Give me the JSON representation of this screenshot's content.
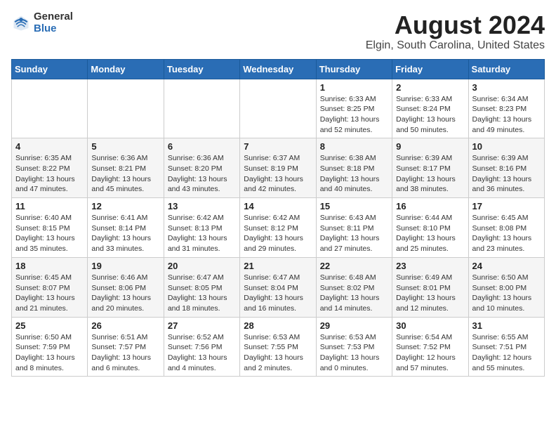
{
  "header": {
    "logo_general": "General",
    "logo_blue": "Blue",
    "title": "August 2024",
    "subtitle": "Elgin, South Carolina, United States"
  },
  "calendar": {
    "weekdays": [
      "Sunday",
      "Monday",
      "Tuesday",
      "Wednesday",
      "Thursday",
      "Friday",
      "Saturday"
    ],
    "weeks": [
      [
        {
          "day": "",
          "content": ""
        },
        {
          "day": "",
          "content": ""
        },
        {
          "day": "",
          "content": ""
        },
        {
          "day": "",
          "content": ""
        },
        {
          "day": "1",
          "content": "Sunrise: 6:33 AM\nSunset: 8:25 PM\nDaylight: 13 hours\nand 52 minutes."
        },
        {
          "day": "2",
          "content": "Sunrise: 6:33 AM\nSunset: 8:24 PM\nDaylight: 13 hours\nand 50 minutes."
        },
        {
          "day": "3",
          "content": "Sunrise: 6:34 AM\nSunset: 8:23 PM\nDaylight: 13 hours\nand 49 minutes."
        }
      ],
      [
        {
          "day": "4",
          "content": "Sunrise: 6:35 AM\nSunset: 8:22 PM\nDaylight: 13 hours\nand 47 minutes."
        },
        {
          "day": "5",
          "content": "Sunrise: 6:36 AM\nSunset: 8:21 PM\nDaylight: 13 hours\nand 45 minutes."
        },
        {
          "day": "6",
          "content": "Sunrise: 6:36 AM\nSunset: 8:20 PM\nDaylight: 13 hours\nand 43 minutes."
        },
        {
          "day": "7",
          "content": "Sunrise: 6:37 AM\nSunset: 8:19 PM\nDaylight: 13 hours\nand 42 minutes."
        },
        {
          "day": "8",
          "content": "Sunrise: 6:38 AM\nSunset: 8:18 PM\nDaylight: 13 hours\nand 40 minutes."
        },
        {
          "day": "9",
          "content": "Sunrise: 6:39 AM\nSunset: 8:17 PM\nDaylight: 13 hours\nand 38 minutes."
        },
        {
          "day": "10",
          "content": "Sunrise: 6:39 AM\nSunset: 8:16 PM\nDaylight: 13 hours\nand 36 minutes."
        }
      ],
      [
        {
          "day": "11",
          "content": "Sunrise: 6:40 AM\nSunset: 8:15 PM\nDaylight: 13 hours\nand 35 minutes."
        },
        {
          "day": "12",
          "content": "Sunrise: 6:41 AM\nSunset: 8:14 PM\nDaylight: 13 hours\nand 33 minutes."
        },
        {
          "day": "13",
          "content": "Sunrise: 6:42 AM\nSunset: 8:13 PM\nDaylight: 13 hours\nand 31 minutes."
        },
        {
          "day": "14",
          "content": "Sunrise: 6:42 AM\nSunset: 8:12 PM\nDaylight: 13 hours\nand 29 minutes."
        },
        {
          "day": "15",
          "content": "Sunrise: 6:43 AM\nSunset: 8:11 PM\nDaylight: 13 hours\nand 27 minutes."
        },
        {
          "day": "16",
          "content": "Sunrise: 6:44 AM\nSunset: 8:10 PM\nDaylight: 13 hours\nand 25 minutes."
        },
        {
          "day": "17",
          "content": "Sunrise: 6:45 AM\nSunset: 8:08 PM\nDaylight: 13 hours\nand 23 minutes."
        }
      ],
      [
        {
          "day": "18",
          "content": "Sunrise: 6:45 AM\nSunset: 8:07 PM\nDaylight: 13 hours\nand 21 minutes."
        },
        {
          "day": "19",
          "content": "Sunrise: 6:46 AM\nSunset: 8:06 PM\nDaylight: 13 hours\nand 20 minutes."
        },
        {
          "day": "20",
          "content": "Sunrise: 6:47 AM\nSunset: 8:05 PM\nDaylight: 13 hours\nand 18 minutes."
        },
        {
          "day": "21",
          "content": "Sunrise: 6:47 AM\nSunset: 8:04 PM\nDaylight: 13 hours\nand 16 minutes."
        },
        {
          "day": "22",
          "content": "Sunrise: 6:48 AM\nSunset: 8:02 PM\nDaylight: 13 hours\nand 14 minutes."
        },
        {
          "day": "23",
          "content": "Sunrise: 6:49 AM\nSunset: 8:01 PM\nDaylight: 13 hours\nand 12 minutes."
        },
        {
          "day": "24",
          "content": "Sunrise: 6:50 AM\nSunset: 8:00 PM\nDaylight: 13 hours\nand 10 minutes."
        }
      ],
      [
        {
          "day": "25",
          "content": "Sunrise: 6:50 AM\nSunset: 7:59 PM\nDaylight: 13 hours\nand 8 minutes."
        },
        {
          "day": "26",
          "content": "Sunrise: 6:51 AM\nSunset: 7:57 PM\nDaylight: 13 hours\nand 6 minutes."
        },
        {
          "day": "27",
          "content": "Sunrise: 6:52 AM\nSunset: 7:56 PM\nDaylight: 13 hours\nand 4 minutes."
        },
        {
          "day": "28",
          "content": "Sunrise: 6:53 AM\nSunset: 7:55 PM\nDaylight: 13 hours\nand 2 minutes."
        },
        {
          "day": "29",
          "content": "Sunrise: 6:53 AM\nSunset: 7:53 PM\nDaylight: 13 hours\nand 0 minutes."
        },
        {
          "day": "30",
          "content": "Sunrise: 6:54 AM\nSunset: 7:52 PM\nDaylight: 12 hours\nand 57 minutes."
        },
        {
          "day": "31",
          "content": "Sunrise: 6:55 AM\nSunset: 7:51 PM\nDaylight: 12 hours\nand 55 minutes."
        }
      ]
    ]
  }
}
